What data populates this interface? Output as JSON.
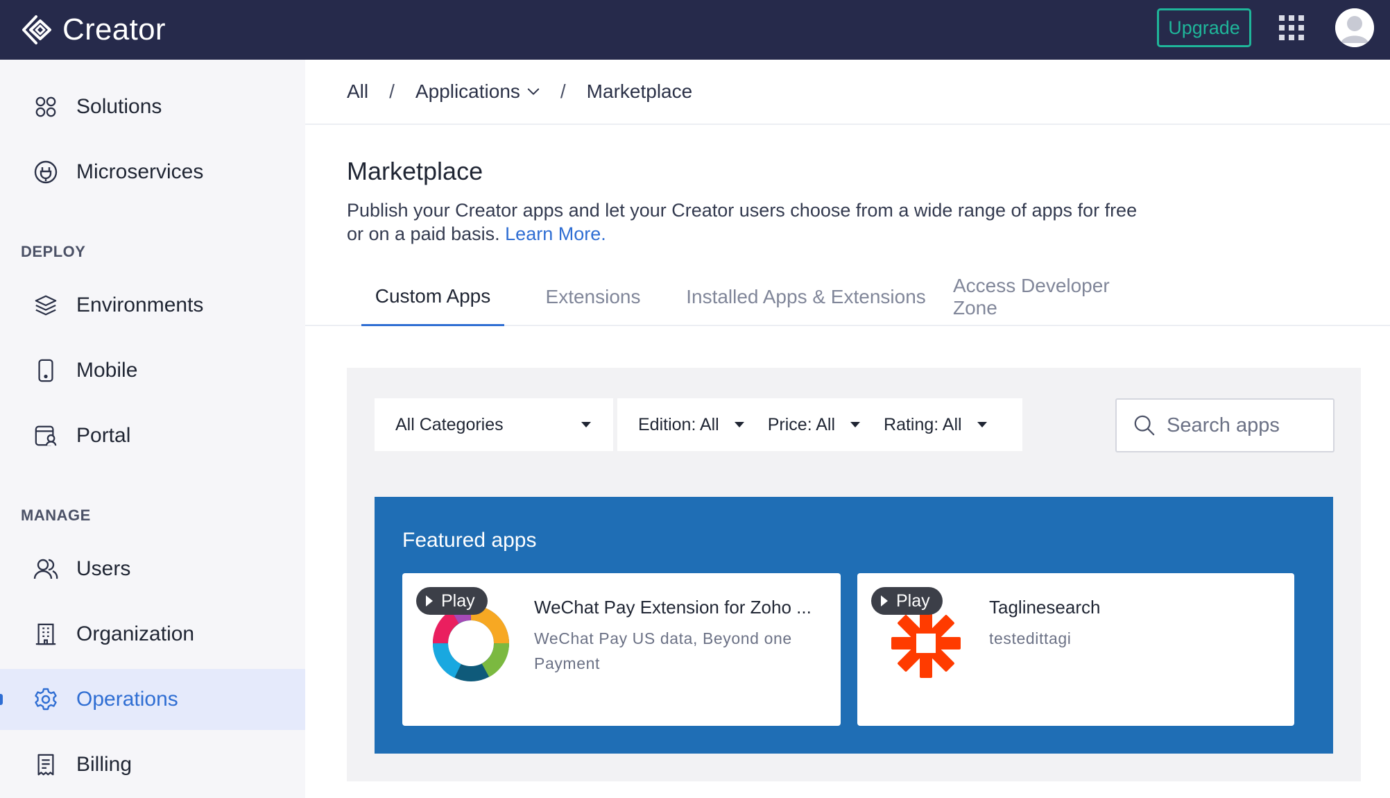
{
  "topbar": {
    "brand": "Creator",
    "upgrade_label": "Upgrade"
  },
  "sidebar": {
    "items_top": [
      {
        "label": "Solutions",
        "icon": "solutions-icon"
      },
      {
        "label": "Microservices",
        "icon": "microservices-icon"
      }
    ],
    "deploy_heading": "DEPLOY",
    "deploy_items": [
      {
        "label": "Environments",
        "icon": "layers-icon"
      },
      {
        "label": "Mobile",
        "icon": "mobile-icon"
      },
      {
        "label": "Portal",
        "icon": "portal-icon"
      }
    ],
    "manage_heading": "MANAGE",
    "manage_items": [
      {
        "label": "Users",
        "icon": "users-icon"
      },
      {
        "label": "Organization",
        "icon": "building-icon"
      },
      {
        "label": "Operations",
        "icon": "gear-icon",
        "active": true
      },
      {
        "label": "Billing",
        "icon": "receipt-icon"
      }
    ]
  },
  "breadcrumb": {
    "all": "All",
    "separator": "/",
    "applications": "Applications",
    "current": "Marketplace"
  },
  "page": {
    "title": "Marketplace",
    "description": "Publish your Creator apps and let your Creator users choose from a wide range of apps for free or on a paid basis.",
    "learn_more": "Learn More."
  },
  "tabs": [
    {
      "label": "Custom Apps",
      "active": true
    },
    {
      "label": "Extensions",
      "active": false
    },
    {
      "label": "Installed Apps & Extensions",
      "active": false
    },
    {
      "label": "Access Developer Zone",
      "active": false
    }
  ],
  "filters": {
    "categories": "All Categories",
    "edition": "Edition: All",
    "price": "Price: All",
    "rating": "Rating: All"
  },
  "search": {
    "placeholder": "Search apps"
  },
  "featured": {
    "title": "Featured apps",
    "apps": [
      {
        "badge": "Play",
        "name": "WeChat Pay Extension for Zoho ...",
        "description": "WeChat Pay US data, Beyond one Payment",
        "logo": "multicolor-ring-logo"
      },
      {
        "badge": "Play",
        "name": "Taglinesearch",
        "description": "testedittagi",
        "logo": "orange-asterisk-logo"
      }
    ]
  },
  "colors": {
    "topbar": "#262a4b",
    "accent": "#2f6ed3",
    "upgrade": "#1fb69a",
    "featured_bg": "#1f6eb5"
  }
}
